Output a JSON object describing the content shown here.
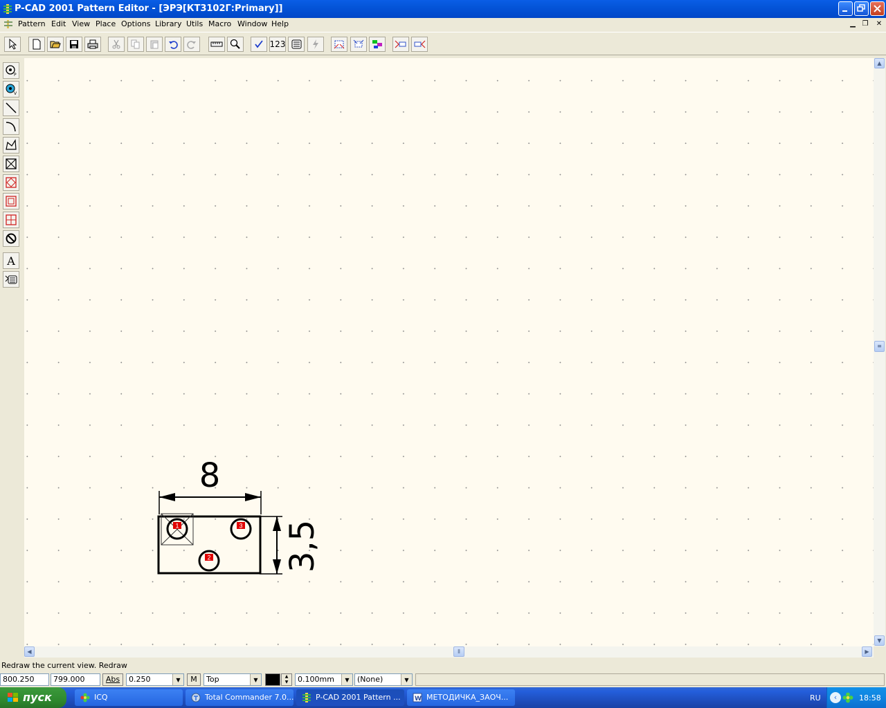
{
  "window": {
    "title": "P-CAD 2001 Pattern Editor - [ЭРЭ[КТ3102Г:Primary]]"
  },
  "menu": [
    "Pattern",
    "Edit",
    "View",
    "Place",
    "Options",
    "Library",
    "Utils",
    "Macro",
    "Window",
    "Help"
  ],
  "toolbar": {
    "number_button": "123"
  },
  "drawing": {
    "width_dimension": "8",
    "height_dimension": "3,5",
    "pads": [
      "1",
      "3",
      "2"
    ],
    "pad_color": "#e00000"
  },
  "status": {
    "message": "Redraw the current view. Redraw",
    "x_coord": "800.250",
    "y_coord": "799.000",
    "abs_label": "Abs",
    "grid": "0.250",
    "m_label": "M",
    "layer": "Top",
    "line_width": "0.100mm",
    "style": "(None)"
  },
  "taskbar": {
    "start_label": "пуск",
    "tasks": [
      "ICQ",
      "Total Commander 7.0...",
      "P-CAD 2001 Pattern ...",
      "МЕТОДИЧКА_ЗАОЧ..."
    ],
    "language": "RU",
    "clock": "18:58"
  },
  "colors": {
    "titlebar": "#0454d8",
    "canvas": "#fffbf0",
    "taskbar": "#245edb",
    "start": "#2f8a2f"
  }
}
